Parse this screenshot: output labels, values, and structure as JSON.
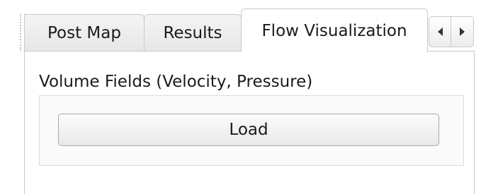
{
  "tabs": [
    {
      "label": "Post Map",
      "active": false
    },
    {
      "label": "Results",
      "active": false
    },
    {
      "label": "Flow Visualization",
      "active": true
    }
  ],
  "tab_scroll": {
    "left_icon": "chevron-left-icon",
    "right_icon": "chevron-right-icon"
  },
  "panel": {
    "section_label": "Volume Fields (Velocity, Pressure)",
    "load_label": "Load"
  }
}
